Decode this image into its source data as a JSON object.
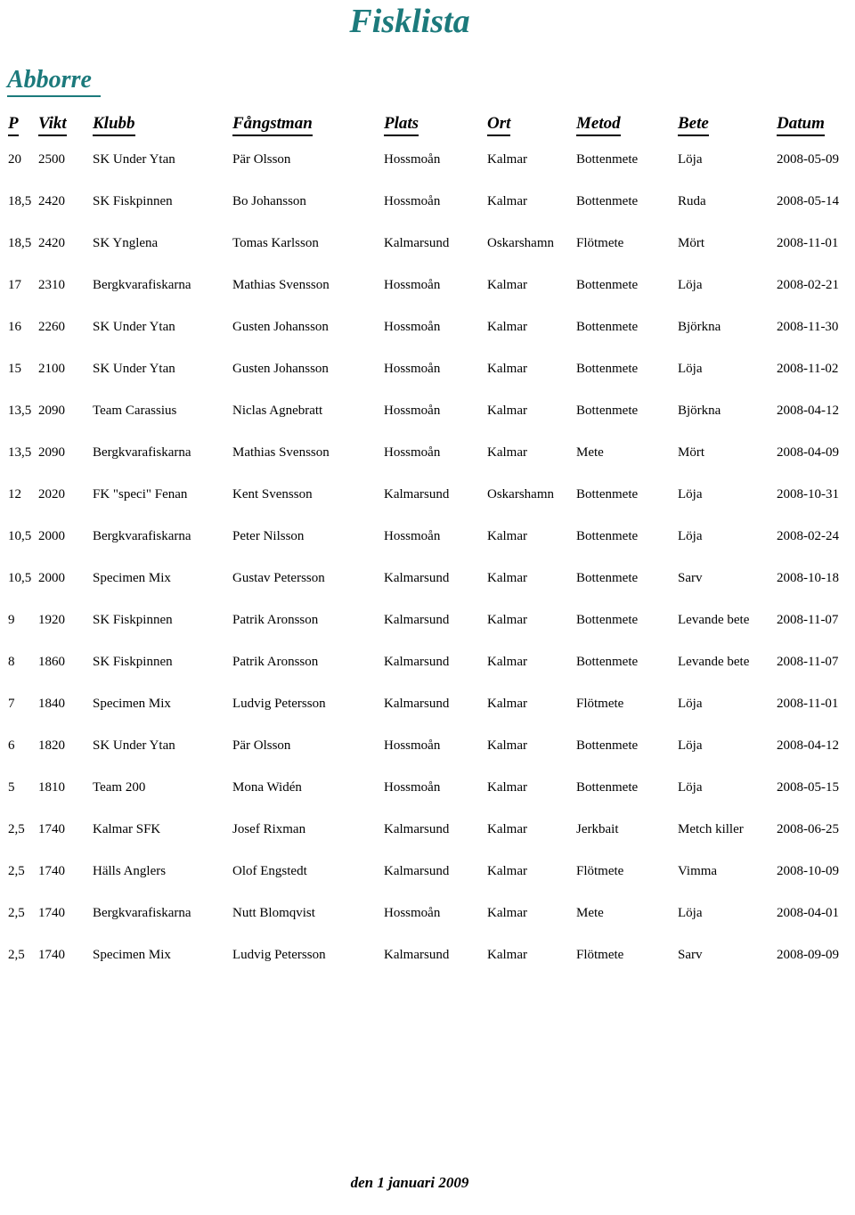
{
  "document": {
    "title": "Fisklista",
    "title_color": "#1C7A7C",
    "footer": "den 1 januari 2009"
  },
  "section": {
    "heading": "Abborre",
    "heading_color": "#1C7A7C"
  },
  "table": {
    "headers": {
      "p": "P",
      "vikt": "Vikt",
      "klubb": "Klubb",
      "fangstman": "Fångstman",
      "plats": "Plats",
      "ort": "Ort",
      "metod": "Metod",
      "bete": "Bete",
      "datum": "Datum"
    },
    "rows": [
      {
        "p": "20",
        "vikt": "2500",
        "klubb": "SK Under Ytan",
        "fangstman": "Pär Olsson",
        "plats": "Hossmoån",
        "ort": "Kalmar",
        "metod": "Bottenmete",
        "bete": "Löja",
        "datum": "2008-05-09"
      },
      {
        "p": "18,5",
        "vikt": "2420",
        "klubb": "SK Fiskpinnen",
        "fangstman": "Bo Johansson",
        "plats": "Hossmoån",
        "ort": "Kalmar",
        "metod": "Bottenmete",
        "bete": "Ruda",
        "datum": "2008-05-14"
      },
      {
        "p": "18,5",
        "vikt": "2420",
        "klubb": "SK Ynglena",
        "fangstman": "Tomas Karlsson",
        "plats": "Kalmarsund",
        "ort": "Oskarshamn",
        "metod": "Flötmete",
        "bete": "Mört",
        "datum": "2008-11-01"
      },
      {
        "p": "17",
        "vikt": "2310",
        "klubb": "Bergkvarafiskarna",
        "fangstman": "Mathias Svensson",
        "plats": "Hossmoån",
        "ort": "Kalmar",
        "metod": "Bottenmete",
        "bete": "Löja",
        "datum": "2008-02-21"
      },
      {
        "p": "16",
        "vikt": "2260",
        "klubb": "SK Under Ytan",
        "fangstman": "Gusten Johansson",
        "plats": "Hossmoån",
        "ort": "Kalmar",
        "metod": "Bottenmete",
        "bete": "Björkna",
        "datum": "2008-11-30"
      },
      {
        "p": "15",
        "vikt": "2100",
        "klubb": "SK Under Ytan",
        "fangstman": "Gusten Johansson",
        "plats": "Hossmoån",
        "ort": "Kalmar",
        "metod": "Bottenmete",
        "bete": "Löja",
        "datum": "2008-11-02"
      },
      {
        "p": "13,5",
        "vikt": "2090",
        "klubb": "Team Carassius",
        "fangstman": "Niclas Agnebratt",
        "plats": "Hossmoån",
        "ort": "Kalmar",
        "metod": "Bottenmete",
        "bete": "Björkna",
        "datum": "2008-04-12"
      },
      {
        "p": "13,5",
        "vikt": "2090",
        "klubb": "Bergkvarafiskarna",
        "fangstman": "Mathias Svensson",
        "plats": "Hossmoån",
        "ort": "Kalmar",
        "metod": "Mete",
        "bete": "Mört",
        "datum": "2008-04-09"
      },
      {
        "p": "12",
        "vikt": "2020",
        "klubb": "FK \"speci\" Fenan",
        "fangstman": "Kent Svensson",
        "plats": "Kalmarsund",
        "ort": "Oskarshamn",
        "metod": "Bottenmete",
        "bete": "Löja",
        "datum": "2008-10-31"
      },
      {
        "p": "10,5",
        "vikt": "2000",
        "klubb": "Bergkvarafiskarna",
        "fangstman": "Peter Nilsson",
        "plats": "Hossmoån",
        "ort": "Kalmar",
        "metod": "Bottenmete",
        "bete": "Löja",
        "datum": "2008-02-24"
      },
      {
        "p": "10,5",
        "vikt": "2000",
        "klubb": "Specimen Mix",
        "fangstman": "Gustav Petersson",
        "plats": "Kalmarsund",
        "ort": "Kalmar",
        "metod": "Bottenmete",
        "bete": "Sarv",
        "datum": "2008-10-18"
      },
      {
        "p": "9",
        "vikt": "1920",
        "klubb": "SK Fiskpinnen",
        "fangstman": "Patrik Aronsson",
        "plats": "Kalmarsund",
        "ort": "Kalmar",
        "metod": "Bottenmete",
        "bete": "Levande bete",
        "datum": "2008-11-07"
      },
      {
        "p": "8",
        "vikt": "1860",
        "klubb": "SK Fiskpinnen",
        "fangstman": "Patrik Aronsson",
        "plats": "Kalmarsund",
        "ort": "Kalmar",
        "metod": "Bottenmete",
        "bete": "Levande bete",
        "datum": "2008-11-07"
      },
      {
        "p": "7",
        "vikt": "1840",
        "klubb": "Specimen Mix",
        "fangstman": "Ludvig Petersson",
        "plats": "Kalmarsund",
        "ort": "Kalmar",
        "metod": "Flötmete",
        "bete": "Löja",
        "datum": "2008-11-01"
      },
      {
        "p": "6",
        "vikt": "1820",
        "klubb": "SK Under Ytan",
        "fangstman": "Pär Olsson",
        "plats": "Hossmoån",
        "ort": "Kalmar",
        "metod": "Bottenmete",
        "bete": "Löja",
        "datum": "2008-04-12"
      },
      {
        "p": "5",
        "vikt": "1810",
        "klubb": "Team 200",
        "fangstman": "Mona Widén",
        "plats": "Hossmoån",
        "ort": "Kalmar",
        "metod": "Bottenmete",
        "bete": "Löja",
        "datum": "2008-05-15"
      },
      {
        "p": "2,5",
        "vikt": "1740",
        "klubb": "Kalmar SFK",
        "fangstman": "Josef Rixman",
        "plats": "Kalmarsund",
        "ort": "Kalmar",
        "metod": "Jerkbait",
        "bete": "Metch killer",
        "datum": "2008-06-25"
      },
      {
        "p": "2,5",
        "vikt": "1740",
        "klubb": "Hälls Anglers",
        "fangstman": "Olof Engstedt",
        "plats": "Kalmarsund",
        "ort": "Kalmar",
        "metod": "Flötmete",
        "bete": "Vimma",
        "datum": "2008-10-09"
      },
      {
        "p": "2,5",
        "vikt": "1740",
        "klubb": "Bergkvarafiskarna",
        "fangstman": "Nutt Blomqvist",
        "plats": "Hossmoån",
        "ort": "Kalmar",
        "metod": "Mete",
        "bete": "Löja",
        "datum": "2008-04-01"
      },
      {
        "p": "2,5",
        "vikt": "1740",
        "klubb": "Specimen Mix",
        "fangstman": "Ludvig Petersson",
        "plats": "Kalmarsund",
        "ort": "Kalmar",
        "metod": "Flötmete",
        "bete": "Sarv",
        "datum": "2008-09-09"
      }
    ]
  }
}
